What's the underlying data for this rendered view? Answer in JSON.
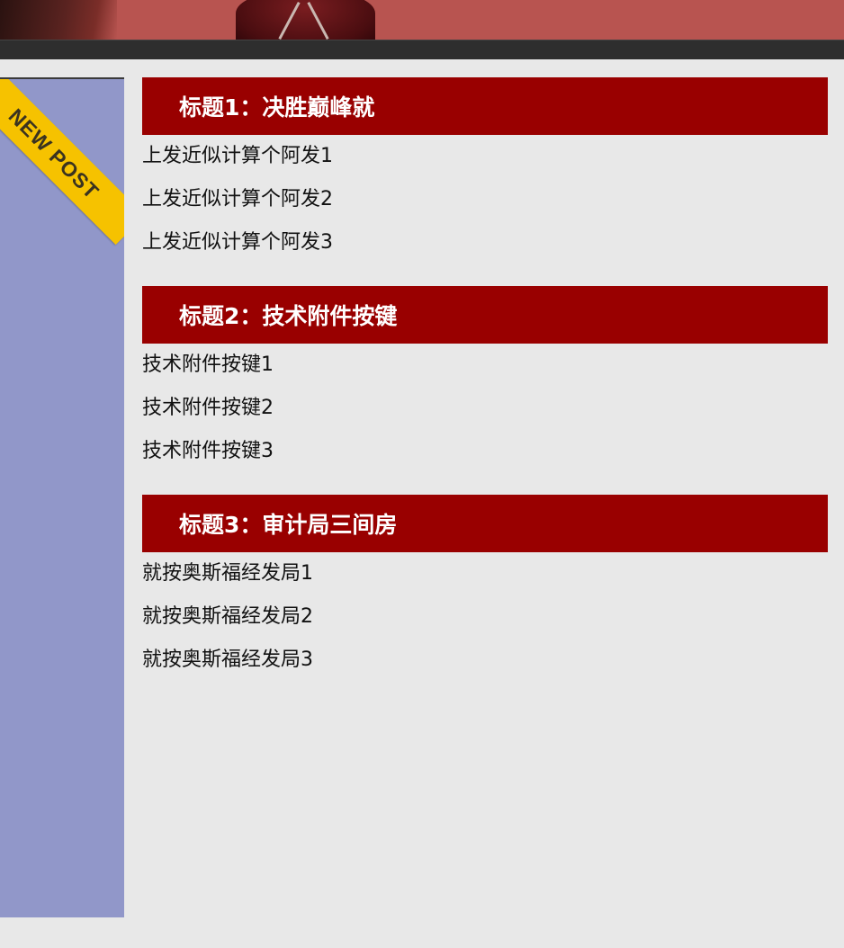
{
  "sidebar": {
    "ribbon_text": "NEW POST"
  },
  "sections": [
    {
      "title": "标题1：决胜巅峰就",
      "items": [
        "上发近似计算个阿发1",
        "上发近似计算个阿发2",
        "上发近似计算个阿发3"
      ]
    },
    {
      "title": "标题2：技术附件按键",
      "items": [
        "技术附件按键1",
        "技术附件按键2",
        "技术附件按键3"
      ]
    },
    {
      "title": "标题3：审计局三间房",
      "items": [
        "就按奥斯福经发局1",
        "就按奥斯福经发局2",
        "就按奥斯福经发局3"
      ]
    }
  ],
  "colors": {
    "section_header_bg": "#990000",
    "sidebar_bg": "#9197c9",
    "ribbon_bg": "#f6c200",
    "page_bg": "#e8e8e8",
    "header_bar_bg": "#2e2e2e"
  }
}
